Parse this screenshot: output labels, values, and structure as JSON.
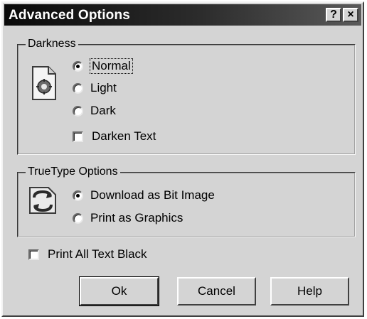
{
  "window": {
    "title": "Advanced Options",
    "help_glyph": "?",
    "close_glyph": "×"
  },
  "darkness": {
    "legend": "Darkness",
    "icon": "document-gear-icon",
    "options": [
      {
        "label": "Normal",
        "checked": true
      },
      {
        "label": "Light",
        "checked": false
      },
      {
        "label": "Dark",
        "checked": false
      }
    ],
    "darken_text": {
      "label": "Darken Text",
      "checked": false
    }
  },
  "truetype": {
    "legend": "TrueType Options",
    "icon": "font-refresh-icon",
    "options": [
      {
        "label": "Download as Bit Image",
        "checked": true
      },
      {
        "label": "Print as Graphics",
        "checked": false
      }
    ]
  },
  "print_all_black": {
    "label": "Print All Text Black",
    "checked": false
  },
  "buttons": {
    "ok": "Ok",
    "cancel": "Cancel",
    "help": "Help"
  }
}
